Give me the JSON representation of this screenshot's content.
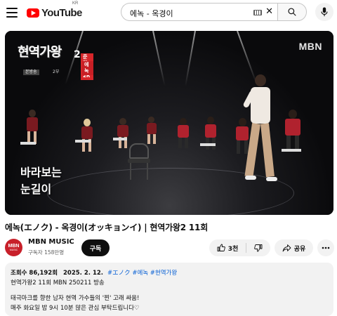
{
  "header": {
    "logo_text": "YouTube",
    "region": "KR",
    "search_value": "에녹 - 옥경이",
    "clear_symbol": "✕"
  },
  "video": {
    "show_title": "현역가왕",
    "show_title_suffix": "2",
    "semifinal_tag": "준결승 2R",
    "genre_tag": "에녹",
    "broadcast_tag": "본방송",
    "broadcast_round": "2부",
    "watermark": "MBN",
    "caption": "바라보는 눈길이"
  },
  "title": "에녹(エノク) - 옥경이(オッキョンイ) | 현역가왕2 11회",
  "channel": {
    "avatar_line1": "MBN",
    "avatar_line2": "MUSIC",
    "name": "MBN MUSIC",
    "subscribers": "구독자 158만명",
    "subscribe_label": "구독"
  },
  "actions": {
    "like_count": "3천",
    "share_label": "공유"
  },
  "description": {
    "views": "조회수 86,192회",
    "date": "2025. 2. 12.",
    "hashtags": "#エノク #에녹 #현역가왕",
    "line1": "현역가왕2 11회 MBN 250211 방송",
    "line2": "태극마크를 향한 남자 현역 가수들의 '찐' 고래 싸움!",
    "line3": "매주 화요일 밤 9시 10분 많은 관심 부탁드립니다♡"
  },
  "icons": {
    "menu": "hamburger-icon",
    "search": "search-icon",
    "keyboard": "keyboard-icon",
    "mic": "microphone-icon",
    "like": "thumbs-up-icon",
    "dislike": "thumbs-down-icon",
    "share": "share-icon",
    "more": "more-horizontal-icon"
  },
  "colors": {
    "brand_red": "#ff0000",
    "subscribe_bg": "#0f0f0f",
    "hashtag": "#065fd4",
    "chip_bg": "#f2f2f2"
  }
}
